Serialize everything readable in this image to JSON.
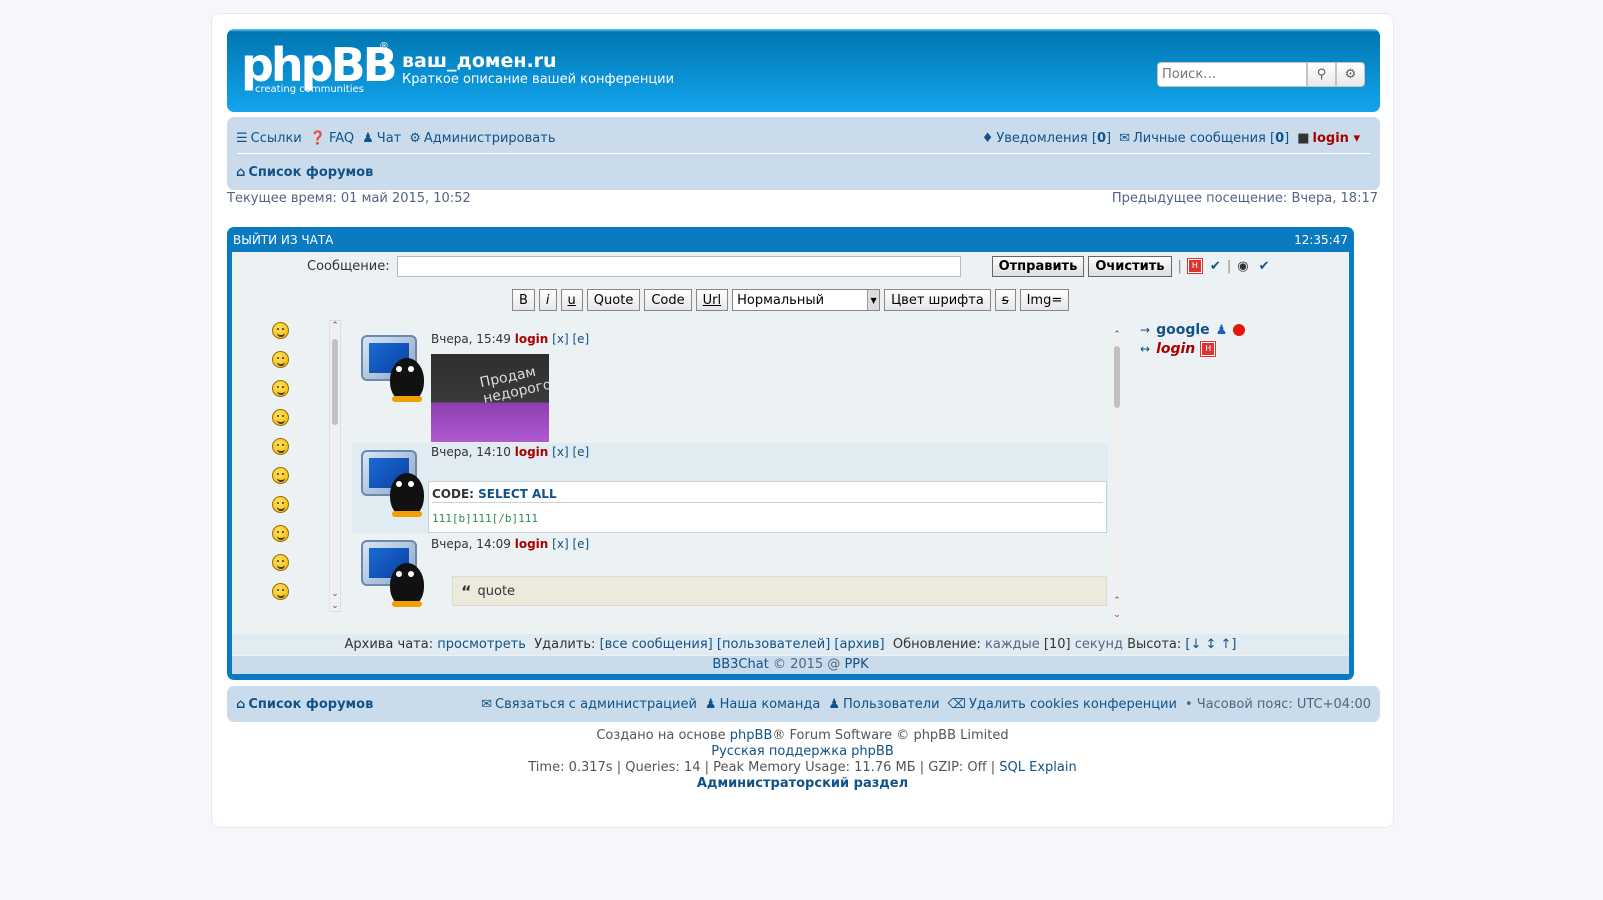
{
  "header": {
    "logo_text": "phpBB",
    "logo_reg": "®",
    "logo_sub": "creating   communities",
    "site_title": "ваш_домен.ru",
    "site_desc": "Краткое описание вашей конференции",
    "search_placeholder": "Поиск…"
  },
  "nav": {
    "links": "Ссылки",
    "faq": "FAQ",
    "chat": "Чат",
    "admin": "Администрировать",
    "notifications": "Уведомления",
    "notifications_count": "0",
    "pm": "Личные сообщения",
    "pm_count": "0",
    "user": "login",
    "forum_list": "Список форумов"
  },
  "time": {
    "current": "Текущее время: 01 май 2015, 10:52",
    "last_visit": "Предыдущее посещение: Вчера, 18:17"
  },
  "chat": {
    "exit": "ВЫЙТИ ИЗ ЧАТА",
    "clock": "12:35:47",
    "message_label": "Сообщение:",
    "send": "Отправить",
    "clear": "Очистить",
    "toolbar": {
      "bold": "B",
      "italic": "i",
      "underline": "u",
      "quote": "Quote",
      "code": "Code",
      "url": "Url",
      "size": "Нормальный",
      "color": "Цвет шрифта",
      "strike": "s",
      "img": "Img="
    },
    "messages": [
      {
        "time": "Вчера, 15:49",
        "user": "login",
        "del": "[x]",
        "edit": "[e]",
        "image_text": "Продам недорого"
      },
      {
        "time": "Вчера, 14:10",
        "user": "login",
        "del": "[x]",
        "edit": "[e]",
        "code_label": "CODE:",
        "select_all": "SELECT ALL",
        "code": "111[b]111[/b]111"
      },
      {
        "time": "Вчера, 14:09",
        "user": "login",
        "del": "[x]",
        "edit": "[e]",
        "quote": "quote"
      }
    ],
    "users": [
      {
        "arrow": "→",
        "name": "google"
      },
      {
        "arrow": "↔",
        "name": "login"
      }
    ],
    "footer": {
      "archive_label": "Архива чата:",
      "archive_view": "просмотреть",
      "delete_label": "Удалить:",
      "delete_all": "[все сообщения]",
      "delete_users": "[пользователей]",
      "delete_archive": "[архив]",
      "update_label": "Обновление:",
      "update_every": "каждые",
      "update_value": "[10]",
      "update_unit": "секунд",
      "height_label": "Высота:",
      "height_ctrl": "[↓ ↕ ↑]"
    },
    "copyright_link": "BB3Chat",
    "copyright_mid": "© 2015 @",
    "copyright_author": "PPK"
  },
  "footer": {
    "forum_list": "Список форумов",
    "contact": "Связаться с администрацией",
    "team": "Наша команда",
    "members": "Пользователи",
    "cookies": "Удалить cookies конференции",
    "timezone": "• Часовой пояс: UTC+04:00",
    "powered_pre": "Создано на основе",
    "powered_link": "phpBB",
    "powered_post": "® Forum Software © phpBB Limited",
    "ru_support": "Русская поддержка phpBB",
    "stats": "Time: 0.317s | Queries: 14 | Peak Memory Usage: 11.76 МБ | GZIP: Off |",
    "sql_explain": "SQL Explain",
    "acp": "Администраторский раздел"
  }
}
